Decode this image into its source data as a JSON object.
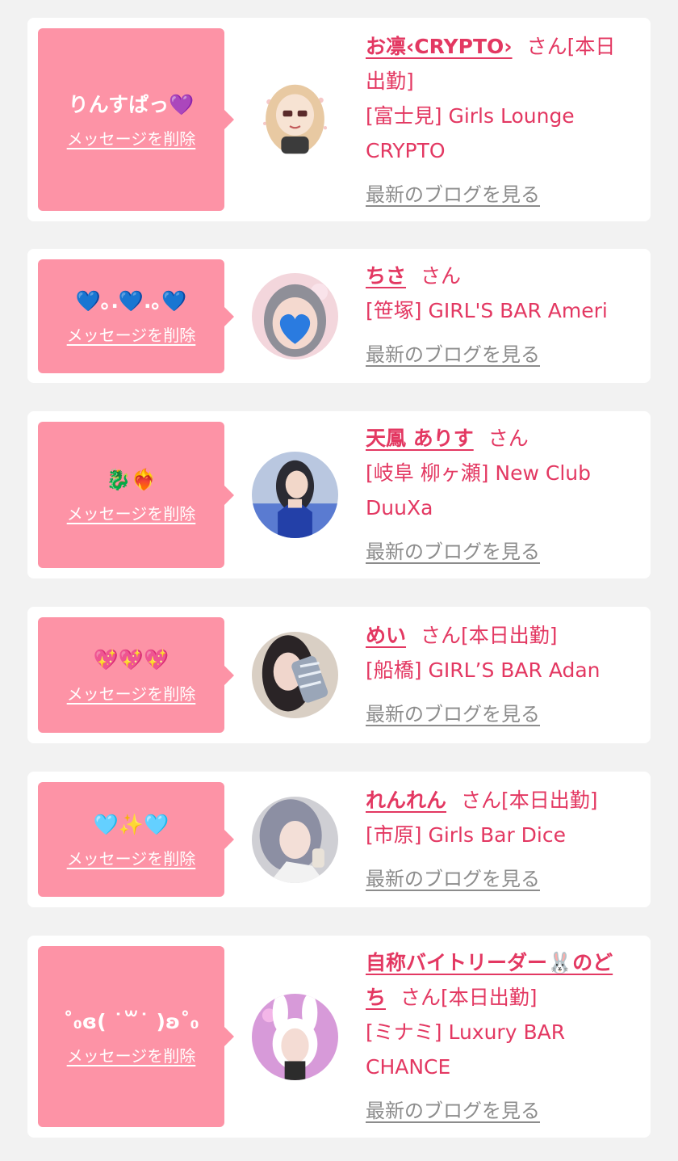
{
  "colors": {
    "page_background": "#f2f2f2",
    "card_background": "#ffffff",
    "bubble": "#fd93a6",
    "accent_text": "#e33862",
    "link_gray": "#8c8c8c"
  },
  "common": {
    "delete_label": "メッセージを削除",
    "blog_label": "最新のブログを見る"
  },
  "messages": [
    {
      "stamp": "りんすぱっ💜",
      "name": "お凛‹CRYPTO›",
      "honorific": "さん",
      "status": "[本日出勤]",
      "shop": "[富士見] Girls Lounge CRYPTO",
      "avatar_icon": "cartoon-girl-avatar"
    },
    {
      "stamp": "💙｡.💙.｡💙",
      "name": "ちさ",
      "honorific": "さん",
      "status": "",
      "shop": "[笹塚] GIRL'S BAR Ameri",
      "avatar_icon": "girl-heart-face-avatar"
    },
    {
      "stamp": "🐉❤️‍🔥",
      "name": "天鳳 ありす",
      "honorific": "さん",
      "status": "",
      "shop": "[岐阜 柳ヶ瀬] New Club DuuXa",
      "avatar_icon": "girl-blue-dress-avatar"
    },
    {
      "stamp": "💖💖💖",
      "name": "めい",
      "honorific": "さん",
      "status": "[本日出勤]",
      "shop": "[船橋] GIRL’S BAR Adan",
      "avatar_icon": "girl-selfie-avatar"
    },
    {
      "stamp": "🩵✨🩵",
      "name": "れんれん",
      "honorific": "さん",
      "status": "[本日出勤]",
      "shop": "[市原] Girls Bar Dice",
      "avatar_icon": "girl-silver-hair-avatar"
    },
    {
      "stamp": "˚₀ɞ( ˙꒳˙ )ʚ˚₀",
      "name": "自称バイトリーダー🐰のどち",
      "honorific": "さん",
      "status": "[本日出勤]",
      "shop": "[ミナミ] Luxury BAR CHANCE",
      "avatar_icon": "girl-bunny-ears-avatar"
    }
  ]
}
